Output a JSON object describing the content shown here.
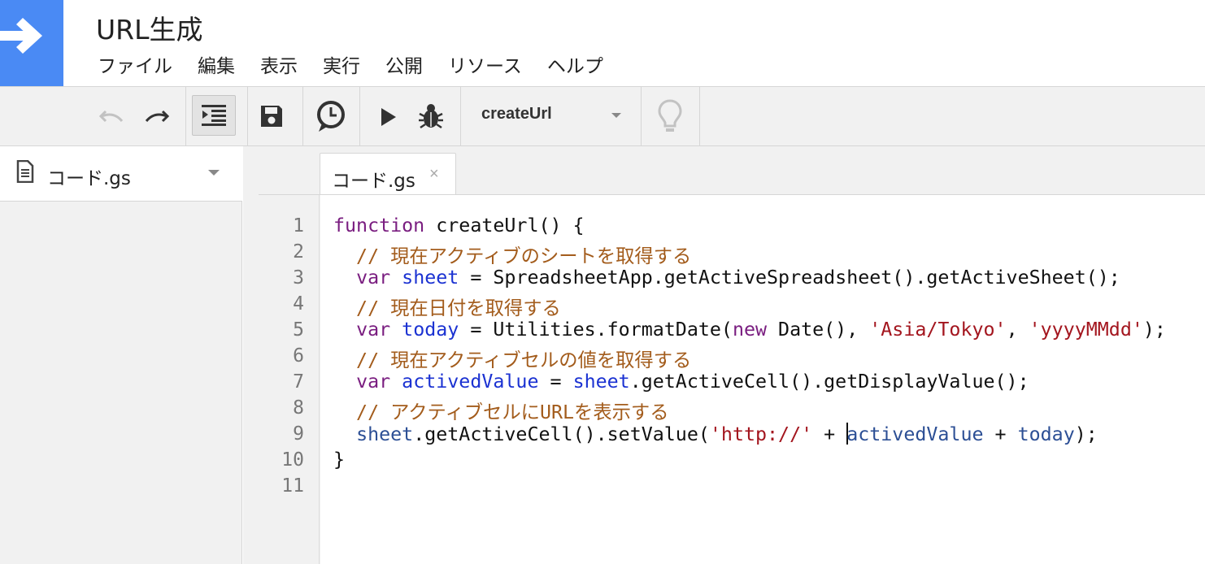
{
  "header": {
    "title": "URL生成",
    "menu": [
      "ファイル",
      "編集",
      "表示",
      "実行",
      "公開",
      "リソース",
      "ヘルプ"
    ]
  },
  "toolbar": {
    "function_select": "createUrl"
  },
  "sidebar": {
    "file_name": "コード.gs"
  },
  "editor": {
    "tab_name": "コード.gs",
    "tab_close": "×",
    "line_numbers": [
      "1",
      "2",
      "3",
      "4",
      "5",
      "6",
      "7",
      "8",
      "9",
      "10",
      "11"
    ],
    "code": {
      "l1_kw": "function",
      "l1_rest": " createUrl() {",
      "l2_comment": "  // 現在アクティブのシートを取得する",
      "l3_var": "var",
      "l3_name": "sheet",
      "l3_rest": " = SpreadsheetApp.getActiveSpreadsheet().getActiveSheet();",
      "l4_comment": "  // 現在日付を取得する",
      "l5_var": "var",
      "l5_name": "today",
      "l5_a": " = Utilities.formatDate(",
      "l5_new": "new",
      "l5_b": " Date(), ",
      "l5_s1": "'Asia/Tokyo'",
      "l5_c": ", ",
      "l5_s2": "'yyyyMMdd'",
      "l5_d": ");",
      "l6_comment": "  // 現在アクティブセルの値を取得する",
      "l7_var": "var",
      "l7_name": "activedValue",
      "l7_eq": " = ",
      "l7_sheet": "sheet",
      "l7_rest": ".getActiveCell().getDisplayValue();",
      "l8_comment": "  // アクティブセルにURLを表示する",
      "l9_sheet": "sheet",
      "l9_a": ".getActiveCell().setValue(",
      "l9_s": "'http://'",
      "l9_plus1": " + ",
      "l9_v1": "activedValue",
      "l9_plus2": " + ",
      "l9_v2": "today",
      "l9_end": ");",
      "l10": "}"
    }
  },
  "colors": {
    "brand_blue": "#4a8af4",
    "keyword": "#7a1e80",
    "comment": "#a35c1c",
    "string": "#a3151e",
    "variable_def": "#1b32d2",
    "variable": "#2c4f95"
  }
}
